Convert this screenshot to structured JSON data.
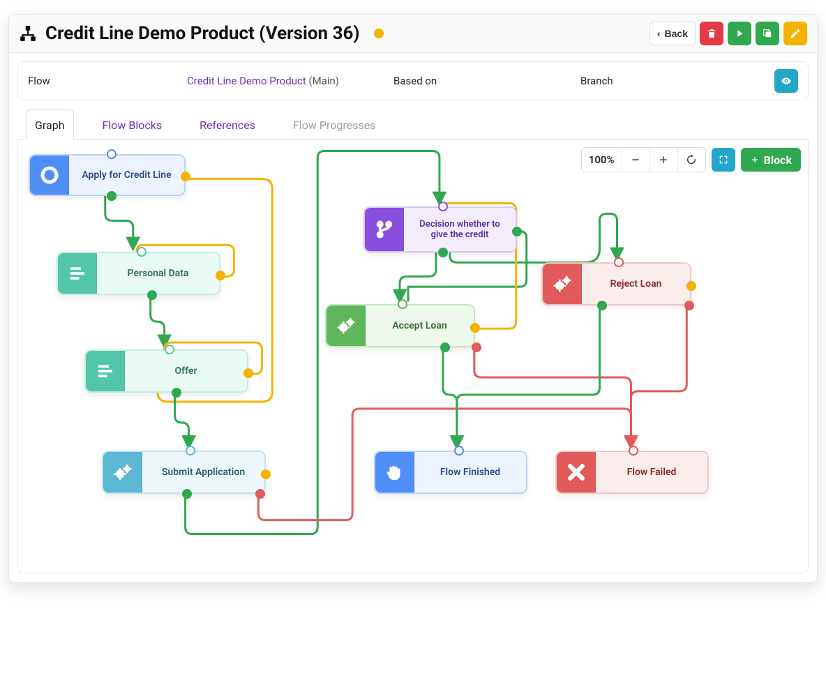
{
  "header": {
    "title": "Credit Line Demo Product (Version 36)",
    "back_label": "Back"
  },
  "info": {
    "flow_label": "Flow",
    "flow_link_text": "Credit Line Demo Product",
    "flow_suffix": "(Main)",
    "based_on_label": "Based on",
    "based_on_value": "",
    "branch_label": "Branch",
    "branch_value": ""
  },
  "tabs": {
    "graph": "Graph",
    "flow_blocks": "Flow Blocks",
    "references": "References",
    "flow_progresses": "Flow Progresses"
  },
  "toolbar": {
    "zoom": "100%",
    "add_block": "Block"
  },
  "nodes": {
    "apply": {
      "label": "Apply for Credit Line"
    },
    "personal": {
      "label": "Personal Data"
    },
    "offer": {
      "label": "Offer"
    },
    "submit": {
      "label": "Submit Application"
    },
    "decision": {
      "label": "Decision whether to give the credit"
    },
    "accept": {
      "label": "Accept Loan"
    },
    "reject": {
      "label": "Reject Loan"
    },
    "finished": {
      "label": "Flow Finished"
    },
    "failed": {
      "label": "Flow Failed"
    }
  },
  "chart_data": {
    "type": "flowchart",
    "nodes": [
      {
        "id": "apply",
        "label": "Apply for Credit Line",
        "kind": "start",
        "color": "blue"
      },
      {
        "id": "personal",
        "label": "Personal Data",
        "kind": "form",
        "color": "teal"
      },
      {
        "id": "offer",
        "label": "Offer",
        "kind": "form",
        "color": "teal"
      },
      {
        "id": "submit",
        "label": "Submit Application",
        "kind": "process",
        "color": "light-blue"
      },
      {
        "id": "decision",
        "label": "Decision whether to give the credit",
        "kind": "branch",
        "color": "purple"
      },
      {
        "id": "accept",
        "label": "Accept Loan",
        "kind": "process",
        "color": "green"
      },
      {
        "id": "reject",
        "label": "Reject Loan",
        "kind": "process",
        "color": "red"
      },
      {
        "id": "finished",
        "label": "Flow Finished",
        "kind": "end-success",
        "color": "blue"
      },
      {
        "id": "failed",
        "label": "Flow Failed",
        "kind": "end-failure",
        "color": "red"
      }
    ],
    "edges": [
      {
        "from": "apply",
        "to": "personal",
        "color": "green"
      },
      {
        "from": "apply",
        "to": "personal",
        "color": "amber"
      },
      {
        "from": "personal",
        "to": "offer",
        "color": "green"
      },
      {
        "from": "personal",
        "to": "offer",
        "color": "amber",
        "path": "loop-right"
      },
      {
        "from": "offer",
        "to": "submit",
        "color": "green"
      },
      {
        "from": "offer",
        "to": "submit",
        "color": "amber"
      },
      {
        "from": "submit",
        "to": "decision",
        "color": "green"
      },
      {
        "from": "submit",
        "to": "failed",
        "color": "red"
      },
      {
        "from": "decision",
        "to": "accept",
        "color": "green"
      },
      {
        "from": "decision",
        "to": "reject",
        "color": "green"
      },
      {
        "from": "decision",
        "to": "accept",
        "color": "green",
        "path": "loop-right"
      },
      {
        "from": "accept",
        "to": "finished",
        "color": "green"
      },
      {
        "from": "accept",
        "to": "decision",
        "color": "amber",
        "path": "loop-right"
      },
      {
        "from": "accept",
        "to": "failed",
        "color": "red"
      },
      {
        "from": "reject",
        "to": "finished",
        "color": "green"
      },
      {
        "from": "reject",
        "to": "failed",
        "color": "red"
      }
    ]
  }
}
